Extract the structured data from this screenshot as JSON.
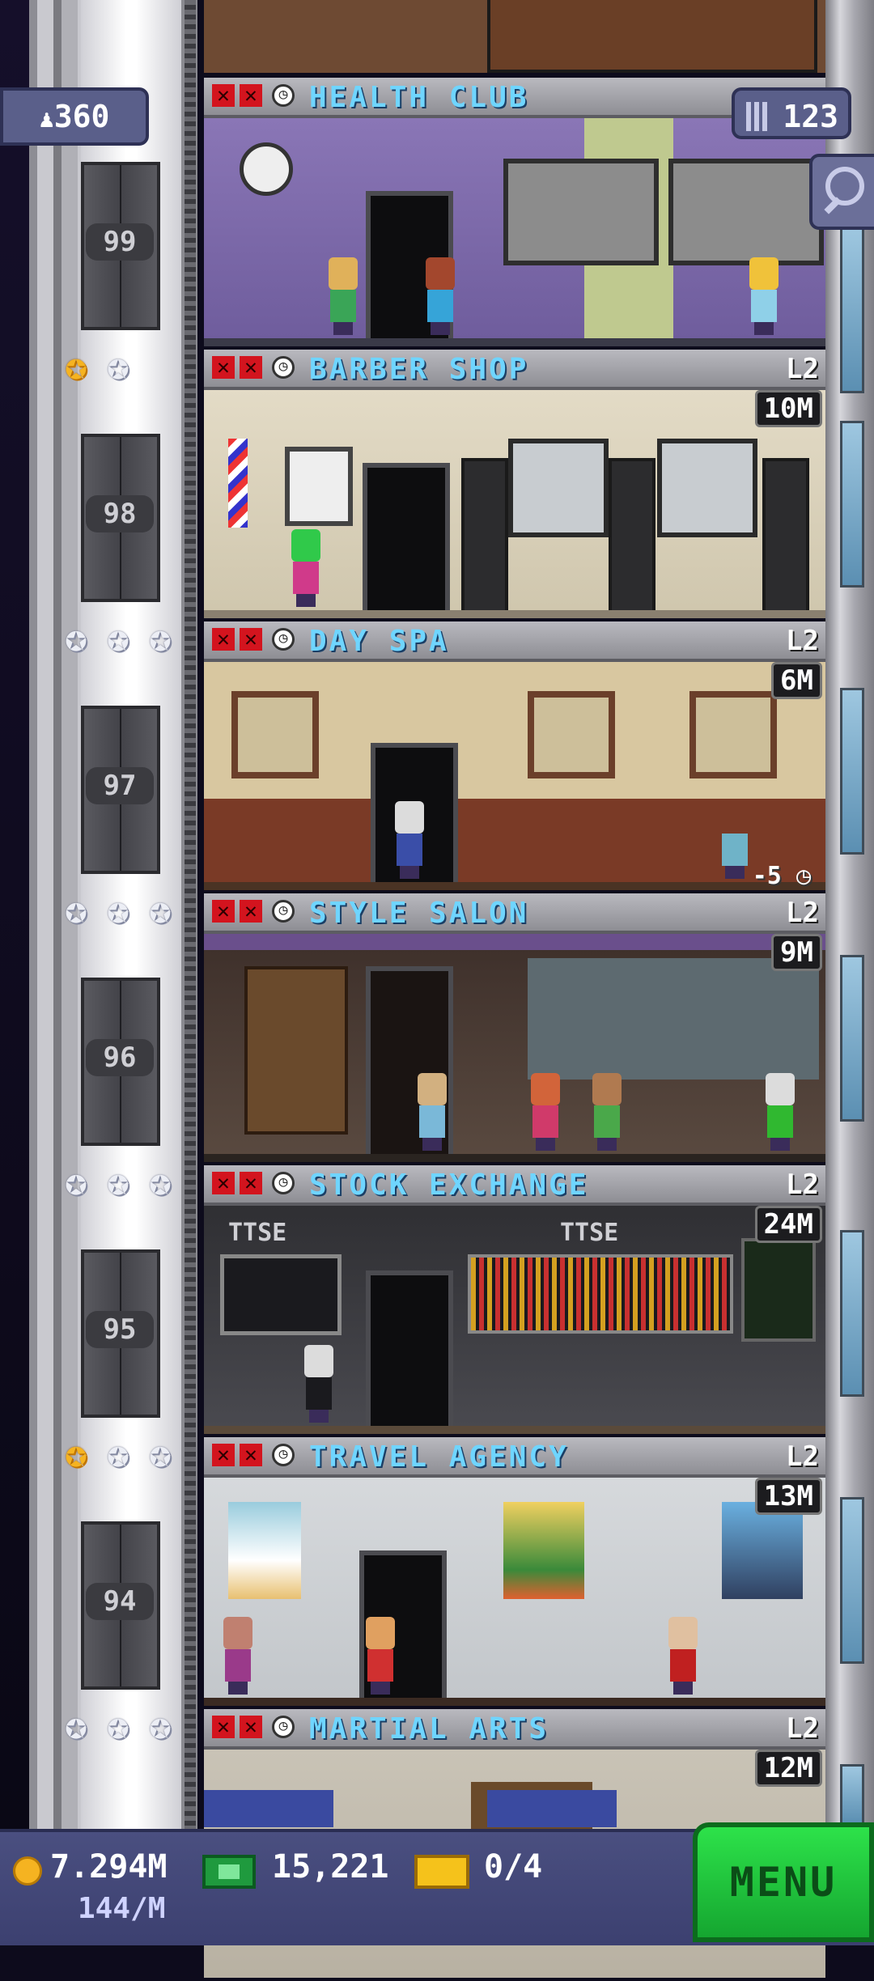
{
  "hud": {
    "population": "360",
    "floor_count": "123",
    "coins": "7.294M",
    "coins_rate": "144/M",
    "tower_bux": "15,221",
    "tickets": "0/4",
    "menu_label": "MENU"
  },
  "floors": [
    {
      "number": "99",
      "name": "HEALTH CLUB",
      "level": "",
      "income": "",
      "stars": []
    },
    {
      "number": "98",
      "name": "BARBER SHOP",
      "level": "L2",
      "income": "10M",
      "stars": [
        "gold",
        "silver"
      ]
    },
    {
      "number": "97",
      "name": "DAY SPA",
      "level": "L2",
      "income": "6M",
      "stars": [
        "silver",
        "silver",
        "silver"
      ],
      "timer": "-5"
    },
    {
      "number": "96",
      "name": "STYLE SALON",
      "level": "L2",
      "income": "9M",
      "stars": [
        "silver",
        "silver",
        "silver"
      ]
    },
    {
      "number": "95",
      "name": "STOCK EXCHANGE",
      "level": "L2",
      "income": "24M",
      "stars": [
        "silver",
        "silver",
        "silver"
      ],
      "signs": [
        "TTSE",
        "TTSE"
      ]
    },
    {
      "number": "94",
      "name": "TRAVEL AGENCY",
      "level": "L2",
      "income": "13M",
      "stars": [
        "gold",
        "silver",
        "silver"
      ]
    },
    {
      "number": "",
      "name": "MARTIAL ARTS",
      "level": "L2",
      "income": "12M",
      "stars": [
        "silver",
        "silver",
        "silver"
      ]
    }
  ],
  "colors": {
    "title_text": "#6fd5ff",
    "menu_green": "#2de24a",
    "hud_panel": "#4a4f80",
    "close_red": "#d3141e"
  },
  "icons": [
    "population-icon",
    "floors-icon",
    "search-icon",
    "coin-icon",
    "bux-icon",
    "ticket-icon",
    "clock-icon",
    "star-icon"
  ]
}
